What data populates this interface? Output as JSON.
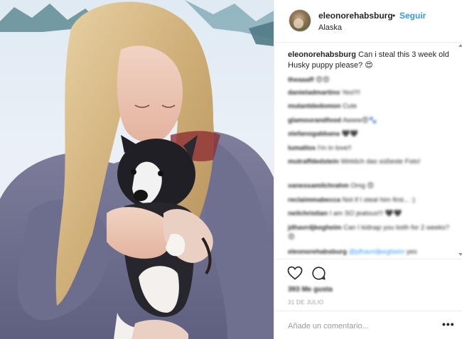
{
  "post": {
    "username": "eleonorehabsburg",
    "separator": "•",
    "follow_label": "Seguir",
    "location": "Alaska",
    "caption_user": "eleonorehabsburg",
    "caption_text": "Can i steal this 3 week old Husky puppy please? 😍"
  },
  "comments": [
    {
      "user": "theaaaff",
      "text": "😍😍"
    },
    {
      "user": "danieladmartino",
      "text": "Yes!!!!"
    },
    {
      "user": "mutantdedomon",
      "text": "Cute"
    },
    {
      "user": "glamourandfood",
      "text": "Awww😍🐾"
    },
    {
      "user": "stefanogabbana",
      "text": "🖤🖤"
    },
    {
      "user": "lumatlos",
      "text": "I'm in love!!"
    },
    {
      "user": "mutraffdedstein",
      "text": "Wirklich das süßeste Foto!"
    },
    {
      "user": "vanessamilchrahm",
      "text": "Omg 😍"
    },
    {
      "user": "reclaimmabecca",
      "text": "Not if I steal him first... :)"
    },
    {
      "user": "neilchristian",
      "text": "I am SO jealous!!! 🖤🖤"
    },
    {
      "user": "jdhavrdjkegheim",
      "text": "Can I kidnap you both for 2 weeks? 😍"
    },
    {
      "user": "eleonorehabsburg",
      "mention": "@jdhavrdjkegheim",
      "text": "yes"
    }
  ],
  "actions": {
    "heart_icon": "heart-outline",
    "comment_icon": "speech-bubble-outline",
    "likes": "393 Me gusta",
    "date": "31 DE JULIO"
  },
  "add_comment": {
    "placeholder": "Añade un comentario...",
    "more_label": "•••"
  },
  "colors": {
    "link_blue": "#3897f0",
    "text": "#262626",
    "muted": "#999999",
    "border": "#efefef"
  }
}
